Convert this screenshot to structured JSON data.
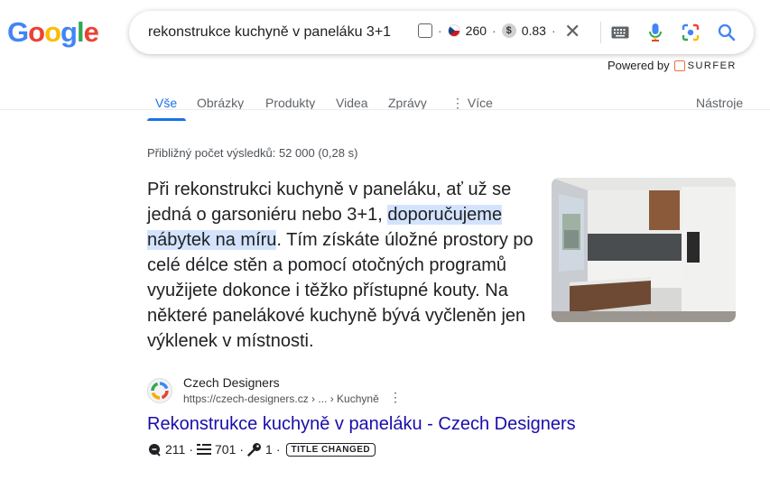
{
  "logo": {
    "letters": [
      "G",
      "o",
      "o",
      "g",
      "l",
      "e"
    ],
    "colors": [
      "#4285f4",
      "#ea4335",
      "#fbbc05",
      "#4285f4",
      "#34a853",
      "#ea4335"
    ]
  },
  "search": {
    "query": "rekonstrukce kuchyně v paneláku 3+1",
    "extension": {
      "volume": "260",
      "cpc": "0.83",
      "flag_icon": "czech-flag-icon",
      "currency_icon": "dollar-icon"
    }
  },
  "powered_by": {
    "label": "Powered by",
    "brand": "SURFER"
  },
  "tabs": [
    {
      "label": "Vše",
      "active": true
    },
    {
      "label": "Obrázky"
    },
    {
      "label": "Produkty"
    },
    {
      "label": "Videa"
    },
    {
      "label": "Zprávy"
    },
    {
      "label": "⋮ Více"
    },
    {
      "label": "Nástroje"
    }
  ],
  "stats": "Přibližný počet výsledků: 52 000 (0,28 s)",
  "snippet": {
    "before": "Při rekonstrukci kuchyně v paneláku, ať už se jedná o garsoniéru nebo 3+1, ",
    "highlight": "doporučujeme nábytek na míru",
    "after": ". Tím získáte úložné prostory po celé délce stěn a pomocí otočných programů využijete dokonce i těžko přístupné kouty. Na některé panelákové kuchyně bývá vyčleněn jen výklenek v místnosti."
  },
  "result": {
    "site_name": "Czech Designers",
    "url": "https://czech-designers.cz › ... › Kuchyně",
    "title": "Rekonstrukce kuchyně v paneláku - Czech Designers",
    "metrics": {
      "referring": "211",
      "words": "701",
      "keywords": "1",
      "badge": "TITLE CHANGED"
    }
  },
  "colors": {
    "link": "#1a0dab",
    "accent": "#1a73e8",
    "highlight": "#d3e3fd",
    "surfer": "#f26e3e"
  }
}
